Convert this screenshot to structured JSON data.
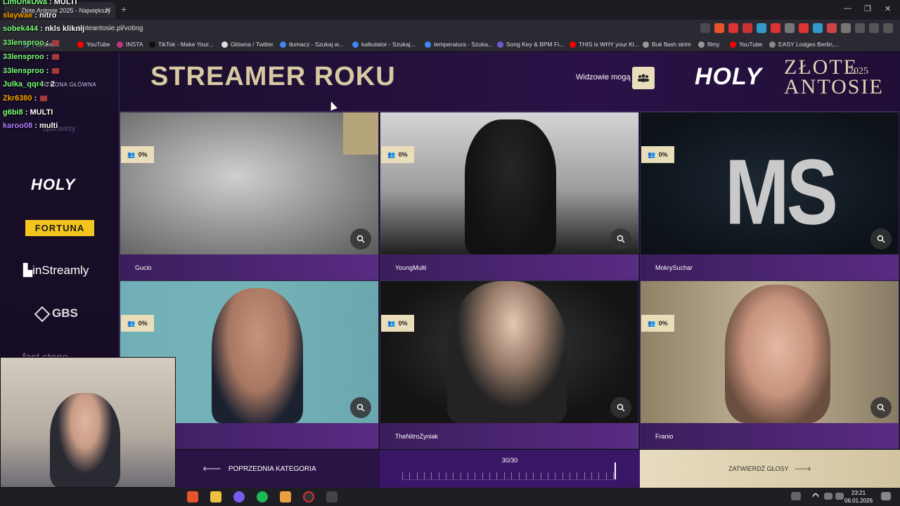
{
  "browser": {
    "tab_title": "Złote Antosie 2025 - Największy",
    "url": "zloteantosie.pl/voting",
    "bookmarks": [
      {
        "label": "Facebook",
        "color": "#3b5998"
      },
      {
        "label": "YouTube",
        "color": "#ff0000"
      },
      {
        "label": "INSTA",
        "color": "#c13584"
      },
      {
        "label": "TikTok - Make Your...",
        "color": "#111111"
      },
      {
        "label": "Główna / Twitter",
        "color": "#dddddd"
      },
      {
        "label": "tłumacz - Szukaj w...",
        "color": "#4285f4"
      },
      {
        "label": "kalkulator - Szukaj...",
        "color": "#4285f4"
      },
      {
        "label": "temperatura - Szuka...",
        "color": "#4285f4"
      },
      {
        "label": "Song Key & BPM Fi...",
        "color": "#6a5acd"
      },
      {
        "label": "THIS is WHY your Kl...",
        "color": "#ff0000"
      },
      {
        "label": "Buk flash strim",
        "color": "#999999"
      },
      {
        "label": "filmy",
        "color": "#999999"
      },
      {
        "label": "YouTube",
        "color": "#ff0000"
      },
      {
        "label": "EASY Lodges Berlin,...",
        "color": "#888888"
      }
    ]
  },
  "chat": [
    {
      "user": "LimUnkUwa",
      "msg": "MULTI",
      "color": "#7fff7f"
    },
    {
      "user": "slaywae",
      "msg": "nitro",
      "color": "#ffa500"
    },
    {
      "user": "sobek444",
      "msg": "nkls kliknij",
      "color": "#7fff7f"
    },
    {
      "user": "33lensproo",
      "msg": "",
      "color": "#7fff7f"
    },
    {
      "user": "33lensproo",
      "msg": "",
      "color": "#7fff7f"
    },
    {
      "user": "33lensproo",
      "msg": "",
      "color": "#7fff7f"
    },
    {
      "user": "Julka_qqr4",
      "msg": "2",
      "color": "#7fff7f"
    },
    {
      "user": "Zkr6380",
      "msg": "",
      "color": "#ffa500"
    },
    {
      "user": "g6bi8",
      "msg": "MULTI",
      "color": "#7fff7f"
    },
    {
      "user": "karoo08",
      "msg": "multi",
      "color": "#b07fff"
    }
  ],
  "sidebar": {
    "home_label": "STRONA GŁÓWNA",
    "sponsors_label": "Sponsorzy",
    "sponsors": [
      "HOLY",
      "FORTUNA",
      "inStreamly",
      "GBS",
      "fast stone"
    ]
  },
  "header": {
    "title": "STREAMER ROKU",
    "viewers_label": "Widzowie mogą",
    "logo_brand": "HOLY",
    "logo_line1": "ZŁOTE",
    "logo_line2": "ANTOSIE",
    "logo_year": "2025"
  },
  "candidates": [
    {
      "name": "Gucio",
      "percent": "0%"
    },
    {
      "name": "YoungMulti",
      "percent": "0%"
    },
    {
      "name": "MokrySuchar",
      "percent": "0%",
      "photo_text": "MS"
    },
    {
      "name": "",
      "percent": "0%"
    },
    {
      "name": "TheNitroZyniak",
      "percent": "0%"
    },
    {
      "name": "Franio",
      "percent": "0%"
    }
  ],
  "footer": {
    "prev_label": "POPRZEDNIA KATEGORIA",
    "progress_label": "30/30",
    "progress_current": 30,
    "progress_total": 30,
    "confirm_label": "ZATWIERDŹ GŁOSY"
  },
  "taskbar": {
    "time": "23:21",
    "date": "06.01.2026"
  }
}
